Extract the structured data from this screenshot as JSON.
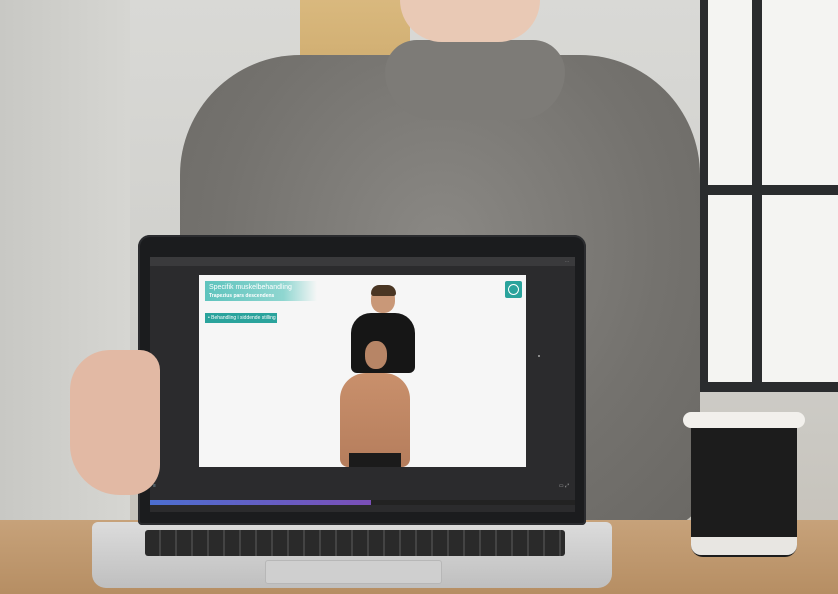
{
  "video_overlay": {
    "title": "Specifik muskelbehandling",
    "subtitle": "Trapezius pars descendens",
    "tag": "• Behandling i siddende stilling",
    "logo_icon": "lambda-logo-icon",
    "accent_color": "#2aa39c"
  },
  "player": {
    "progress": 0.52,
    "controls_left_icon": "menu-icon",
    "controls_right_icons": [
      "speed-icon",
      "fullscreen-icon"
    ]
  },
  "browser": {
    "url_text": "",
    "icons": "⋯"
  }
}
